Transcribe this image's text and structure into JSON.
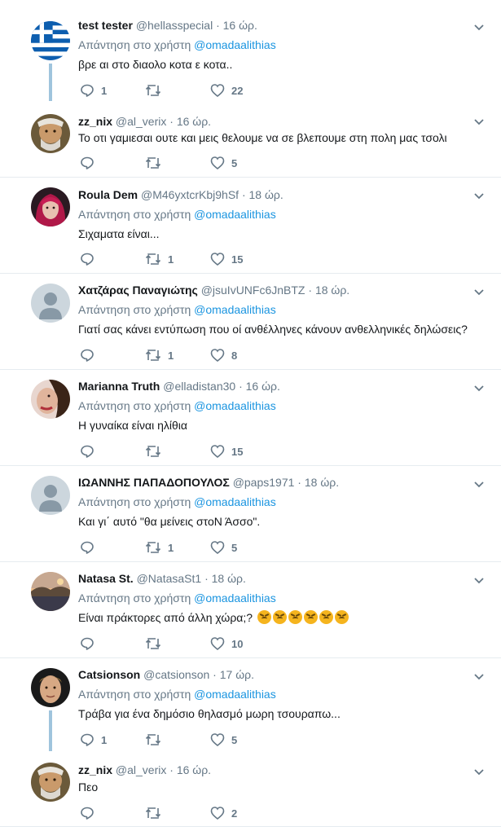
{
  "reply_prefix": "Απάντηση στο χρήστη",
  "tweets": [
    {
      "name": "test tester",
      "handle": "@hellasspecial",
      "dot": "·",
      "time": "16 ώρ.",
      "reply_to": "@omadaalithias",
      "text": "βρε αι στο διαολο κοτα ε κοτα..",
      "replies": "1",
      "retweets": "",
      "likes": "22",
      "avatar": "greek-flag-avatar"
    },
    {
      "name": "zz_nix",
      "handle": "@al_verix",
      "dot": "·",
      "time": "16 ώρ.",
      "reply_to": "",
      "text": "Το οτι γαμιεσαι ουτε και μεις θελουμε να σε βλεπουμε στη πολη μας τσολι",
      "replies": "",
      "retweets": "",
      "likes": "5",
      "avatar": "old-man-avatar"
    },
    {
      "name": "Roula Dem",
      "handle": "@M46yxtcrKbj9hSf",
      "dot": "·",
      "time": "18 ώρ.",
      "reply_to": "@omadaalithias",
      "text": "Σιχαματα είναι...",
      "replies": "",
      "retweets": "1",
      "likes": "15",
      "avatar": "red-hair-avatar"
    },
    {
      "name": "Χατζάρας Παναγιώτης",
      "handle": "@jsuIvUNFc6JnBTZ",
      "dot": "·",
      "time": "18 ώρ.",
      "reply_to": "@omadaalithias",
      "text": "Γιατί σας κάνει εντύπωση που οί ανθέλληνες κάνουν ανθελληνικές δηλώσεις?",
      "replies": "",
      "retweets": "1",
      "likes": "8",
      "avatar": "default-avatar"
    },
    {
      "name": "Marianna Truth",
      "handle": "@elladistan30",
      "dot": "·",
      "time": "16 ώρ.",
      "reply_to": "@omadaalithias",
      "text": "Η γυναίκα είναι ηλίθια",
      "replies": "",
      "retweets": "",
      "likes": "15",
      "avatar": "woman-avatar"
    },
    {
      "name": "ΙΩΑΝΝΗΣ ΠΑΠΑΔΟΠΟΥΛΟΣ",
      "handle": "@paps1971",
      "dot": "·",
      "time": "18 ώρ.",
      "reply_to": "@omadaalithias",
      "text": "Και γι΄ αυτό \"θα μείνεις στοΝ Άσσο\".",
      "replies": "",
      "retweets": "1",
      "likes": "5",
      "avatar": "default-avatar"
    },
    {
      "name": "Natasa St.",
      "handle": "@NatasaSt1",
      "dot": "·",
      "time": "18 ώρ.",
      "reply_to": "@omadaalithias",
      "text": "Είναι πράκτορες από άλλη χώρα;?",
      "replies": "",
      "retweets": "",
      "likes": "10",
      "avatar": "landscape-avatar",
      "emoji_count": 6
    },
    {
      "name": "Catsionson",
      "handle": "@catsionson",
      "dot": "·",
      "time": "17 ώρ.",
      "reply_to": "@omadaalithias",
      "text": "Τράβα για ένα δημόσιο θηλασμό μωρη τσουραπω...",
      "replies": "1",
      "retweets": "",
      "likes": "5",
      "avatar": "man-portrait-avatar"
    },
    {
      "name": "zz_nix",
      "handle": "@al_verix",
      "dot": "·",
      "time": "16 ώρ.",
      "reply_to": "",
      "text": "Πεο",
      "replies": "",
      "retweets": "",
      "likes": "2",
      "avatar": "old-man-avatar"
    }
  ],
  "colors": {
    "accent": "#1b95e0",
    "thread_line": "#9fc4dd",
    "muted": "#657786",
    "text": "#14171a",
    "separator": "#e6ecf0"
  }
}
